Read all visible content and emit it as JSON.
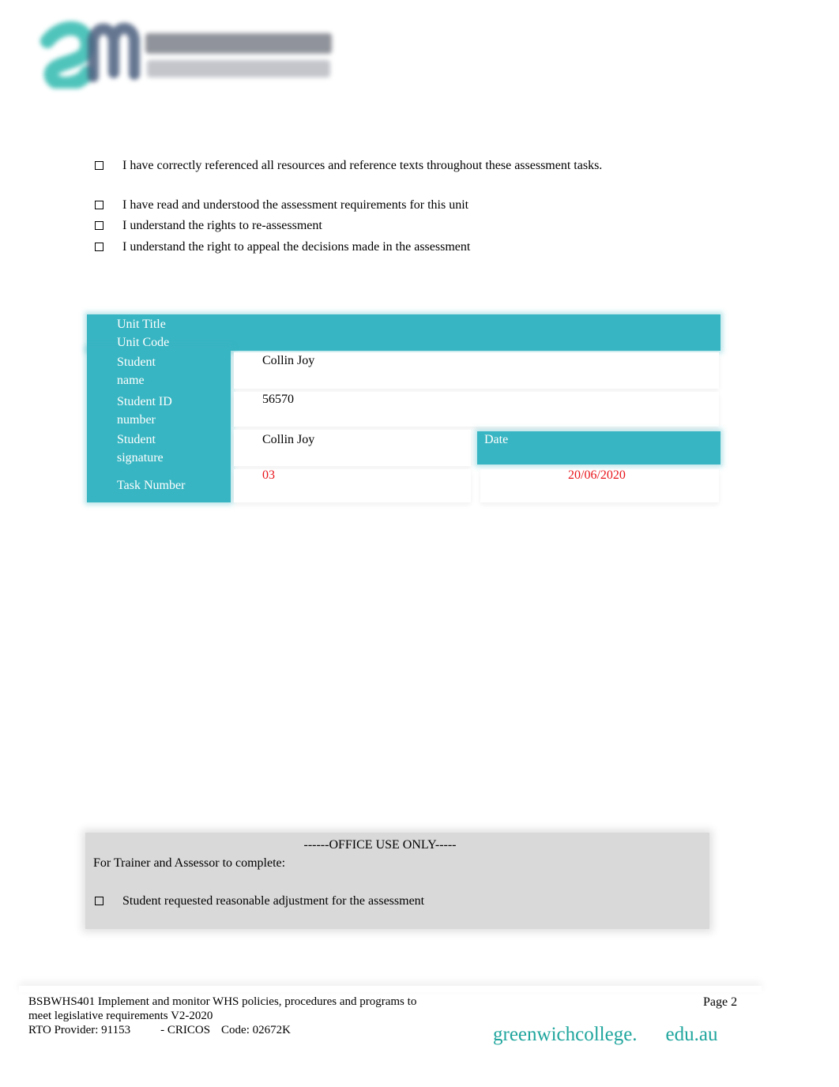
{
  "header": {
    "logo": {
      "name": "Greenwich Management College logo",
      "brand_colors": {
        "teal": "#4fc4bb",
        "navy": "#4a5e7e"
      }
    }
  },
  "declarations": [
    {
      "checked": false,
      "text": "I have correctly referenced all resources and reference texts throughout these assessment tasks."
    },
    {
      "checked": false,
      "text": "I have read and understood the assessment requirements for this unit"
    },
    {
      "checked": false,
      "text": "I understand the rights to re-assessment"
    },
    {
      "checked": false,
      "text": "I understand the right to appeal the decisions made in the assessment"
    }
  ],
  "student_table": {
    "header_color": "#38b5c2",
    "rows": {
      "unit_title": {
        "label": "Unit Title",
        "value": ""
      },
      "unit_code": {
        "label": "Unit Code",
        "value": ""
      },
      "student_name": {
        "label": "Student name",
        "value": "Collin Joy"
      },
      "student_id": {
        "label": "Student ID number",
        "value": "56570"
      },
      "student_signature": {
        "label": "Student signature",
        "value": "Collin Joy"
      },
      "date": {
        "label": "Date",
        "value": "20/06/2020"
      },
      "task_number": {
        "label": "Task Number",
        "value": "03"
      }
    },
    "label_lines": {
      "student_name": [
        "Student",
        "name"
      ],
      "student_id": [
        "Student ID",
        "number"
      ],
      "student_signature": [
        "Student",
        "signature"
      ]
    },
    "highlight_color": "#e8141a"
  },
  "office_use": {
    "title": "------OFFICE USE ONLY-----",
    "subtitle": "For Trainer and Assessor to complete:",
    "items": [
      {
        "checked": false,
        "text": "Student requested reasonable adjustment for the assessment"
      }
    ]
  },
  "footer": {
    "unit_line1": "BSBWHS401 Implement and monitor WHS policies, procedures and programs to",
    "unit_line2": "meet legislative requirements V2-2020",
    "rto": "RTO Provider: 91153",
    "cricos": "- CRICOS",
    "code": "Code: 02672K",
    "page": "Page 2",
    "website_part1": "greenwichcollege.",
    "website_part2": "edu.au",
    "website_color": "#1fa59d"
  }
}
